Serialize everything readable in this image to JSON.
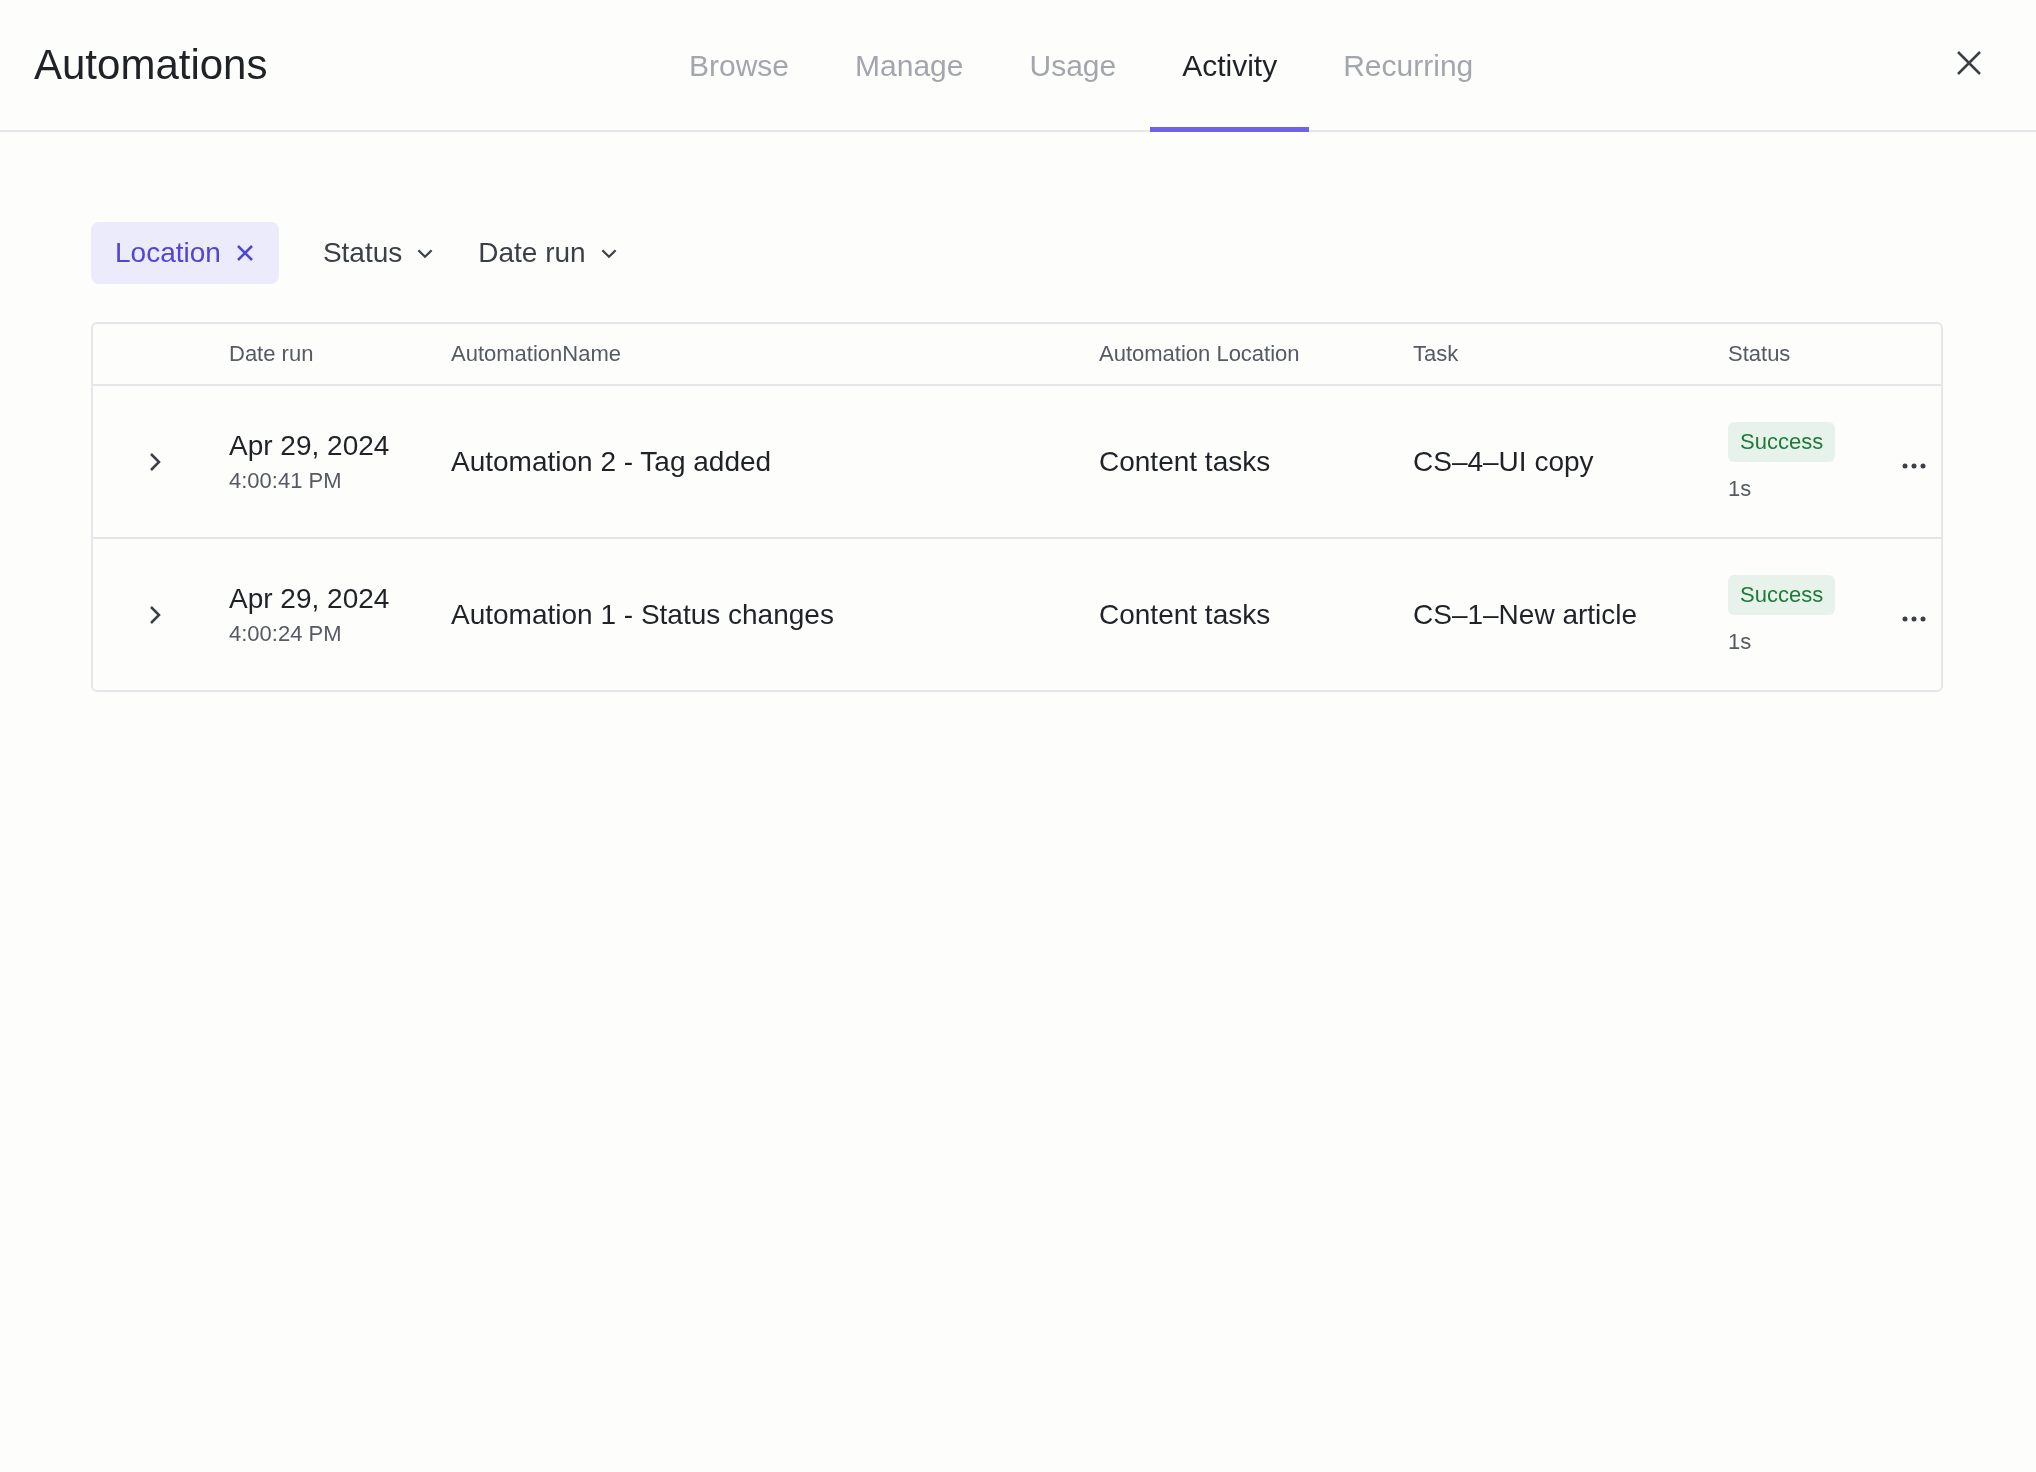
{
  "header": {
    "title": "Automations",
    "tabs": [
      {
        "label": "Browse",
        "selected": false
      },
      {
        "label": "Manage",
        "selected": false
      },
      {
        "label": "Usage",
        "selected": false
      },
      {
        "label": "Activity",
        "selected": true
      },
      {
        "label": "Recurring",
        "selected": false
      }
    ]
  },
  "filters": [
    {
      "label": "Location",
      "kind": "active"
    },
    {
      "label": "Status",
      "kind": "dropdown"
    },
    {
      "label": "Date run",
      "kind": "dropdown"
    }
  ],
  "table": {
    "columns": [
      "Date run",
      "AutomationName",
      "Automation Location",
      "Task",
      "Status"
    ],
    "rows": [
      {
        "date": "Apr 29, 2024",
        "time": "4:00:41 PM",
        "name": "Automation 2 - Tag added",
        "location": "Content tasks",
        "task": "CS–4–UI copy",
        "status": "Success",
        "duration": "1s"
      },
      {
        "date": "Apr 29, 2024",
        "time": "4:00:24 PM",
        "name": "Automation 1 - Status changes",
        "location": "Content tasks",
        "task": "CS–1–New article",
        "status": "Success",
        "duration": "1s"
      }
    ]
  }
}
